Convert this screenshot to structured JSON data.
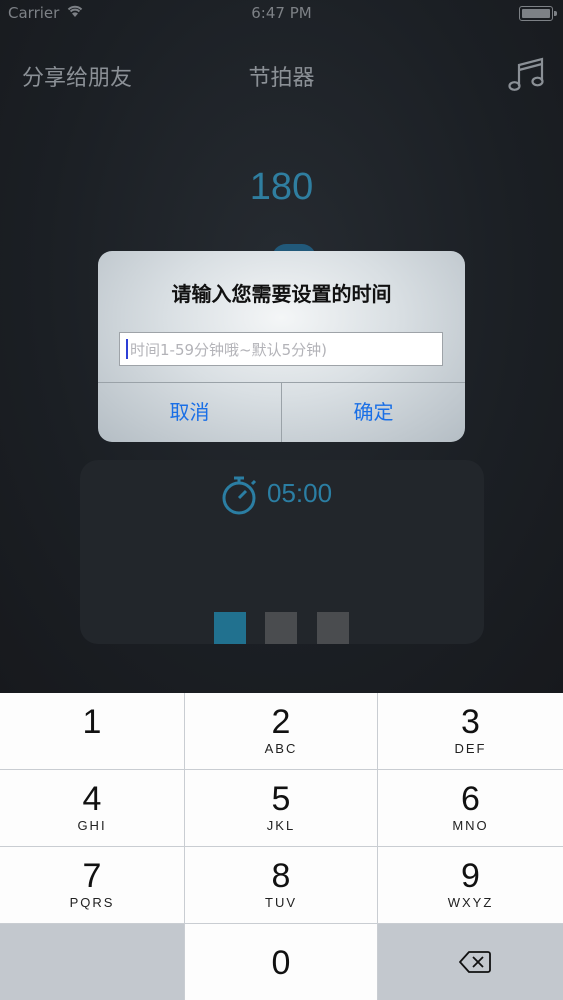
{
  "status_bar": {
    "carrier": "Carrier",
    "time": "6:47 PM"
  },
  "nav": {
    "share": "分享给朋友",
    "title": "节拍器",
    "music_icon": "music-note-icon"
  },
  "metronome": {
    "bpm": "180"
  },
  "timer": {
    "value": "05:00",
    "icon": "stopwatch-icon",
    "colors": {
      "active": "#21718f",
      "inactive": "#4a4c4f"
    }
  },
  "alert": {
    "title": "请输入您需要设置的时间",
    "input_value": "",
    "input_placeholder": "时间1-59分钟哦~默认5分钟)",
    "cancel_label": "取消",
    "confirm_label": "确定",
    "button_color": "#1a6fe6"
  },
  "keypad": {
    "keys": [
      {
        "digit": "1",
        "letters": ""
      },
      {
        "digit": "2",
        "letters": "ABC"
      },
      {
        "digit": "3",
        "letters": "DEF"
      },
      {
        "digit": "4",
        "letters": "GHI"
      },
      {
        "digit": "5",
        "letters": "JKL"
      },
      {
        "digit": "6",
        "letters": "MNO"
      },
      {
        "digit": "7",
        "letters": "PQRS"
      },
      {
        "digit": "8",
        "letters": "TUV"
      },
      {
        "digit": "9",
        "letters": "WXYZ"
      },
      {
        "digit": "0",
        "letters": ""
      }
    ],
    "delete_icon": "backspace-icon"
  }
}
